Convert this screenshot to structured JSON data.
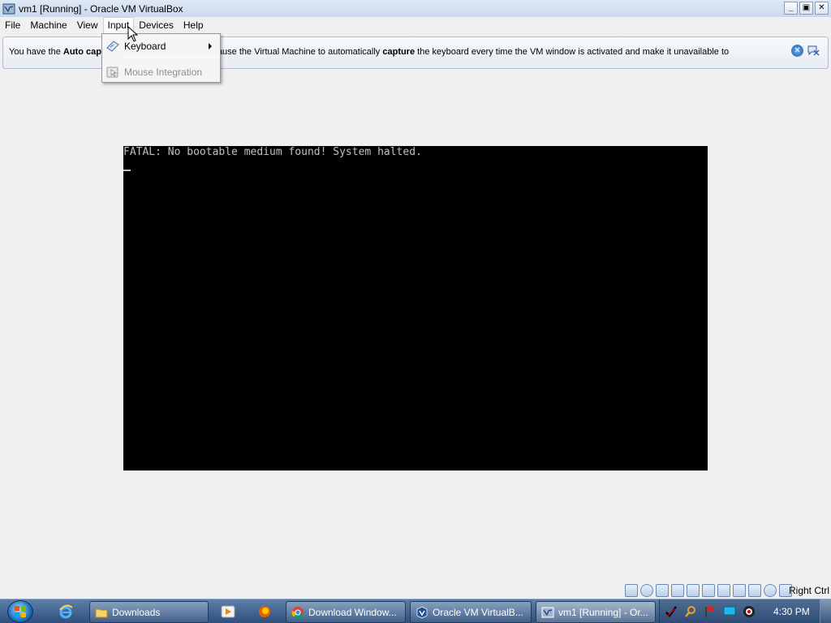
{
  "window": {
    "title": "vm1 [Running] - Oracle VM VirtualBox",
    "controls": {
      "minimize": "_",
      "maximize": "▣",
      "close": "✕"
    }
  },
  "menubar": {
    "items": [
      {
        "label": "File"
      },
      {
        "label": "Machine"
      },
      {
        "label": "View"
      },
      {
        "label": "Input"
      },
      {
        "label": "Devices"
      },
      {
        "label": "Help"
      }
    ]
  },
  "infobar": {
    "msg_prefix": "You have the ",
    "bold1": "Auto cap",
    "msg_mid": "d on. This will cause the Virtual Machine to automatically ",
    "bold2": "capture",
    "msg_suffix": " the keyboard every time the VM window is activated and make it unavailable to"
  },
  "input_menu": {
    "items": [
      {
        "label": "Keyboard",
        "icon": "keyboard-icon",
        "has_submenu": true,
        "enabled": true
      },
      {
        "label": "Mouse Integration",
        "icon": "mouse-integration-icon",
        "has_submenu": false,
        "enabled": false
      }
    ]
  },
  "vm_console": {
    "line1": "FATAL: No bootable medium found! System halted.",
    "cursor": "_"
  },
  "statusbar": {
    "host_key": "Right Ctrl",
    "icons": [
      "hard-disk-icon",
      "optical-drive-icon",
      "floppy-icon",
      "network-icon",
      "usb-icon",
      "shared-folders-icon",
      "display-icon",
      "video-capture-icon",
      "virtualization-icon",
      "mouse-capture-icon",
      "keyboard-capture-icon"
    ]
  },
  "taskbar": {
    "tasks": [
      {
        "label": "Downloads",
        "icon": "folder-icon"
      },
      {
        "label": "Download Window...",
        "icon": "chrome-icon"
      },
      {
        "label": "Oracle VM VirtualB...",
        "icon": "virtualbox-icon"
      },
      {
        "label": "vm1 [Running] - Or...",
        "icon": "vm-window-icon"
      }
    ],
    "clock": "4:30 PM"
  },
  "colors": {
    "accent": "#1f5fb4",
    "console_bg": "#000000",
    "console_text": "#c0c0c0",
    "taskbar": "#2f4f7c"
  }
}
